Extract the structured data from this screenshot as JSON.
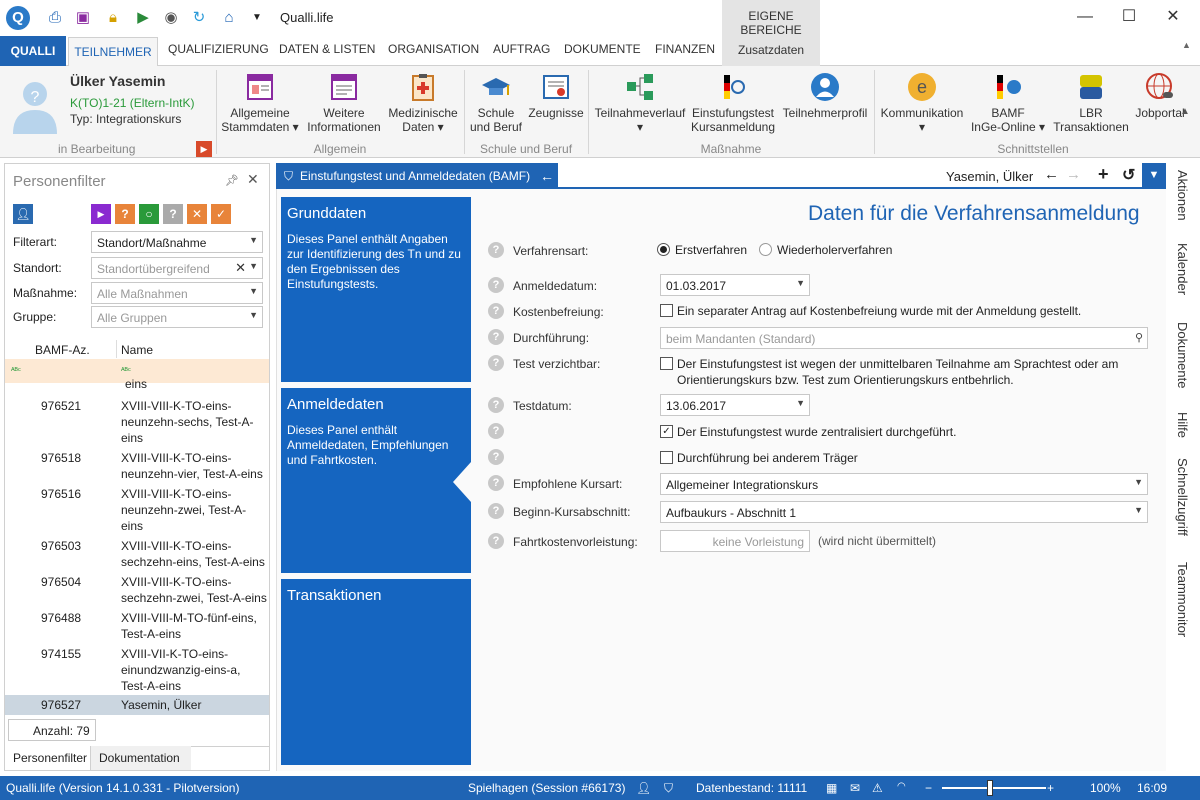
{
  "app": {
    "title": "Qualli.life",
    "eigene_bereiche": "EIGENE BEREICHE"
  },
  "tabs": [
    "QUALLI",
    "TEILNEHMER",
    "QUALIFIZIERUNG",
    "DATEN & LISTEN",
    "ORGANISATION",
    "AUFTRAG",
    "DOKUMENTE",
    "FINANZEN",
    "Zusatzdaten"
  ],
  "person": {
    "name": "Ülker Yasemin",
    "course": "K(TO)1-21 (Eltern-IntK)",
    "type": "Typ: Integrationskurs",
    "state": "in Bearbeitung"
  },
  "ribbon": {
    "allgemein": {
      "group": "Allgemein",
      "items": [
        {
          "line1": "Allgemeine",
          "line2": "Stammdaten ▾"
        },
        {
          "line1": "Weitere",
          "line2": "Informationen"
        },
        {
          "line1": "Medizinische",
          "line2": "Daten ▾"
        }
      ]
    },
    "schule": {
      "group": "Schule und Beruf",
      "items": [
        {
          "line1": "Schule",
          "line2": "und Beruf"
        },
        {
          "line1": "Zeugnisse",
          "line2": ""
        }
      ]
    },
    "massnahme": {
      "group": "Maßnahme",
      "items": [
        {
          "line1": "Teilnahmeverlauf",
          "line2": "▾"
        },
        {
          "line1": "Einstufungstest",
          "line2": "Kursanmeldung"
        },
        {
          "line1": "Teilnehmerprofil",
          "line2": ""
        }
      ]
    },
    "schnitt": {
      "group": "Schnittstellen",
      "items": [
        {
          "line1": "Kommunikation",
          "line2": "▾"
        },
        {
          "line1": "BAMF",
          "line2": "InGe-Online ▾"
        },
        {
          "line1": "LBR",
          "line2": "Transaktionen"
        },
        {
          "line1": "Jobportal",
          "line2": ""
        }
      ]
    }
  },
  "filter": {
    "title": "Personenfilter",
    "fields": [
      {
        "label": "Filterart:",
        "value": "Standort/Maßnahme"
      },
      {
        "label": "Standort:",
        "value": "Standortübergreifend"
      },
      {
        "label": "Maßnahme:",
        "value": "Alle Maßnahmen"
      },
      {
        "label": "Gruppe:",
        "value": "Alle Gruppen"
      }
    ],
    "columns": [
      "BAMF-Az.",
      "Name"
    ],
    "partial_row": "eins",
    "rows": [
      {
        "az": "976521",
        "name": "XVIII-VIII-K-TO-eins-neunzehn-sechs, Test-A-eins"
      },
      {
        "az": "976518",
        "name": "XVIII-VIII-K-TO-eins-neunzehn-vier, Test-A-eins"
      },
      {
        "az": "976516",
        "name": "XVIII-VIII-K-TO-eins-neunzehn-zwei, Test-A-eins"
      },
      {
        "az": "976503",
        "name": "XVIII-VIII-K-TO-eins-sechzehn-eins, Test-A-eins"
      },
      {
        "az": "976504",
        "name": "XVIII-VIII-K-TO-eins-sechzehn-zwei, Test-A-eins"
      },
      {
        "az": "976488",
        "name": "XVIII-VIII-M-TO-fünf-eins, Test-A-eins"
      },
      {
        "az": "974155",
        "name": "XVIII-VII-K-TO-eins-einundzwanzig-eins-a, Test-A-eins"
      },
      {
        "az": "976527",
        "name": "Yasemin, Ülker"
      }
    ],
    "count": "Anzahl: 79",
    "bottom_tabs": [
      "Personenfilter",
      "Dokumentation"
    ]
  },
  "main": {
    "tab_title": "Einstufungstest und Anmeldedaten (BAMF)",
    "person_short": "Yasemin, Ülker",
    "heading": "Daten für die Verfahrensanmeldung",
    "cards": [
      {
        "title": "Grunddaten",
        "text": "Dieses Panel enthält Angaben zur Identifizierung des Tn und zu den Ergebnissen des Einstufungstests."
      },
      {
        "title": "Anmeldedaten",
        "text": "Dieses Panel enthält Anmeldedaten, Empfehlungen und Fahrtkosten."
      },
      {
        "title": "Transaktionen",
        "text": ""
      }
    ],
    "form": {
      "verfahrensart": {
        "label": "Verfahrensart:",
        "opt1": "Erstverfahren",
        "opt2": "Wiederholerverfahren"
      },
      "anmeldedatum": {
        "label": "Anmeldedatum:",
        "value": "01.03.2017"
      },
      "kostenbefreiung": {
        "label": "Kostenbefreiung:",
        "text": "Ein separater Antrag auf Kostenbefreiung wurde mit der Anmeldung gestellt."
      },
      "durchfuehrung": {
        "label": "Durchführung:",
        "placeholder": "beim Mandanten (Standard)"
      },
      "verzichtbar": {
        "label": "Test verzichtbar:",
        "text": "Der Einstufungstest ist wegen der unmittelbaren Teilnahme am Sprachtest oder am Orientierungskurs bzw. Test zum Orientierungskurs entbehrlich."
      },
      "testdatum": {
        "label": "Testdatum:",
        "value": "13.06.2017"
      },
      "zentral": {
        "text": "Der Einstufungstest wurde zentralisiert durchgeführt."
      },
      "anderer": {
        "text": "Durchführung bei anderem Träger"
      },
      "kursart": {
        "label": "Empfohlene Kursart:",
        "value": "Allgemeiner Integrationskurs"
      },
      "abschnitt": {
        "label": "Beginn-Kursabschnitt:",
        "value": "Aufbaukurs - Abschnitt 1"
      },
      "fahrtkosten": {
        "label": "Fahrtkostenvorleistung:",
        "value": "keine Vorleistung",
        "note": "(wird nicht übermittelt)"
      }
    }
  },
  "rail": [
    "Aktionen",
    "Kalender",
    "Dokumente",
    "Hilfe",
    "Schnellzugriff",
    "Teammonitor"
  ],
  "status": {
    "version": "Qualli.life (Version 14.1.0.331 - Pilotversion)",
    "session": "Spielhagen (Session #66173)",
    "datenbestand": "Datenbestand: 11111",
    "zoom": "100%",
    "time": "16:09"
  },
  "colors": {
    "accent": "#1f64b4",
    "card": "#1565c0"
  }
}
